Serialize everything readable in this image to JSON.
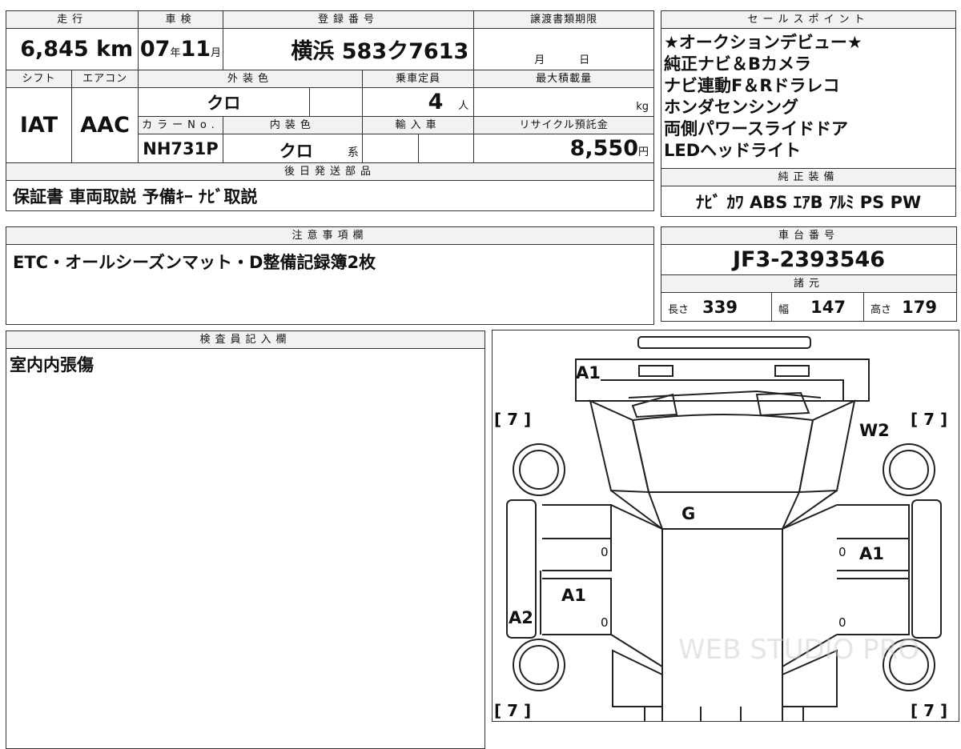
{
  "header": {
    "mileage_label": "走行",
    "inspection_label": "車検",
    "registration_label": "登録番号",
    "transfer_label": "譲渡書類期限",
    "sales_points_label": "セールスポイント"
  },
  "values": {
    "mileage": "6,845",
    "mileage_unit": "km",
    "inspection_year": "07",
    "year_unit": "年",
    "inspection_month": "11",
    "month_unit": "月",
    "registration": "横浜 583ク7613",
    "transfer_month_unit": "月",
    "transfer_day_unit": "日"
  },
  "row2": {
    "shift_label": "シフト",
    "aircon_label": "エアコン",
    "exterior_label": "外装色",
    "capacity_label": "乗車定員",
    "max_load_label": "最大積載量",
    "shift": "IAT",
    "aircon": "AAC",
    "exterior_color": "クロ",
    "capacity": "4",
    "capacity_unit": "人",
    "load_unit": "kg"
  },
  "row3": {
    "color_no_label": "カラーNo.",
    "interior_label": "内装色",
    "import_label": "輸入車",
    "recycle_label": "リサイクル預託金",
    "color_no": "NH731P",
    "interior_color": "クロ",
    "interior_suffix": "系",
    "recycle_fee": "8,550",
    "recycle_unit": "円"
  },
  "sales_points": [
    "★オークションデビュー★",
    "純正ナビ＆Bカメラ",
    "ナビ連動F＆Rドラレコ",
    "ホンダセンシング",
    "両側パワースライドドア",
    "LEDヘッドライト"
  ],
  "later_parts": {
    "label": "後日発送部品",
    "value": "保証書 車両取説 予備ｷｰ ﾅﾋﾞ取説"
  },
  "equipment": {
    "label": "純正装備",
    "value": "ﾅﾋﾞ ｶﾜ ABS ｴｱB ｱﾙﾐ PS PW"
  },
  "notes": {
    "label": "注意事項欄",
    "value": "ETC・オールシーズンマット・D整備記録簿2枚"
  },
  "chassis": {
    "label": "車台番号",
    "value": "JF3-2393546",
    "spec_label": "諸元",
    "length_label": "長さ",
    "length": "339",
    "width_label": "幅",
    "width": "147",
    "height_label": "高さ",
    "height": "179"
  },
  "inspector": {
    "label": "検査員記入欄",
    "value": "室内内張傷"
  },
  "diagram": {
    "marks": {
      "front": "A1",
      "right_front_fender": "W2",
      "windshield": "G",
      "right_front_door": "A1",
      "left_rear_door": "A1",
      "left_quarter": "A2"
    },
    "tire_label": "[ 7 ]",
    "door_zero": "0",
    "watermark": "WEB STUDIO PRO"
  }
}
